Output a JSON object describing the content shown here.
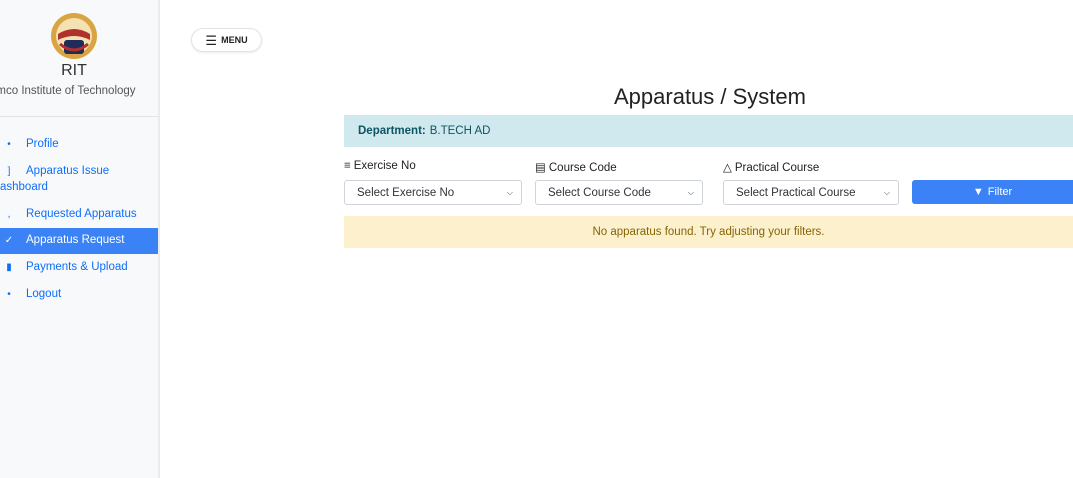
{
  "sidebar": {
    "brand_name": "RIT",
    "brand_sub": "amco Institute of Technology",
    "items": [
      {
        "label": "Profile",
        "icon": "user-icon",
        "glyph": "•"
      },
      {
        "label": "Apparatus Issue",
        "label2": "ashboard",
        "icon": "dashboard-icon",
        "glyph": "]"
      },
      {
        "label": "Requested Apparatus",
        "icon": "list-icon",
        "glyph": ","
      },
      {
        "label": "Apparatus Request",
        "icon": "check-icon",
        "glyph": "✓"
      },
      {
        "label": "Payments & Upload",
        "icon": "upload-icon",
        "glyph": "▮"
      },
      {
        "label": "Logout",
        "icon": "logout-icon",
        "glyph": "•"
      }
    ]
  },
  "menu": {
    "label": "MENU"
  },
  "page": {
    "title": "Apparatus / System"
  },
  "department": {
    "label": "Department:",
    "value": "B.TECH AD"
  },
  "filters": {
    "exercise_label": "Exercise No",
    "exercise_value": "Select Exercise No",
    "course_label": "Course Code",
    "course_value": "Select Course Code",
    "practical_label": "Practical Course",
    "practical_value": "Select Practical Course",
    "filter_button": "Filter"
  },
  "alert": {
    "message": "No apparatus found. Try adjusting your filters."
  },
  "colors": {
    "accent": "#3b82f6",
    "info_bg": "#cfe9ef",
    "warning_bg": "#fdf1cd"
  }
}
